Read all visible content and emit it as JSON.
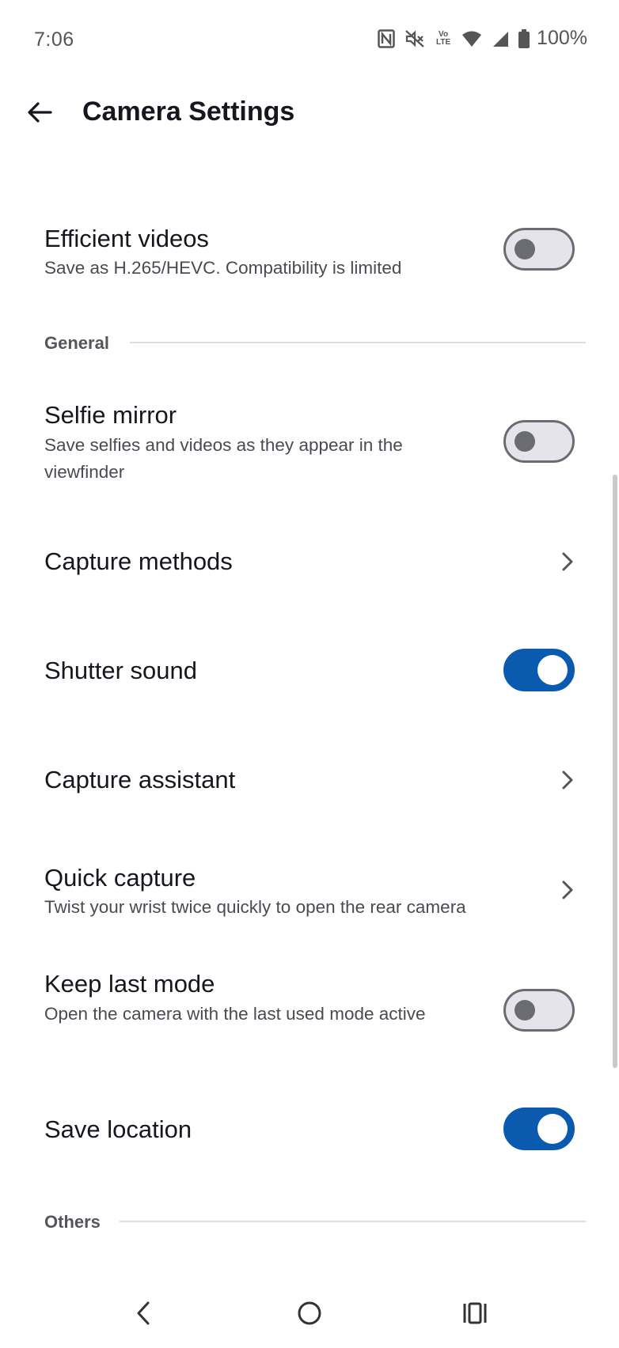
{
  "status_bar": {
    "time": "7:06",
    "battery": "100%",
    "volte_line1": "Vo",
    "volte_line2": "LTE",
    "icons": [
      "nfc-icon",
      "mute-icon",
      "volte-icon",
      "wifi-icon",
      "signal-icon",
      "battery-icon"
    ]
  },
  "header": {
    "title": "Camera Settings",
    "back_icon": "back-arrow-icon"
  },
  "settings": {
    "efficient_videos": {
      "title": "Efficient videos",
      "subtitle": "Save as H.265/HEVC. Compatibility is limited",
      "enabled": false
    },
    "general_header": "General",
    "selfie_mirror": {
      "title": "Selfie mirror",
      "subtitle": "Save selfies and videos as they appear in the viewfinder",
      "enabled": false
    },
    "capture_methods": {
      "title": "Capture methods"
    },
    "shutter_sound": {
      "title": "Shutter sound",
      "enabled": true
    },
    "capture_assistant": {
      "title": "Capture assistant"
    },
    "quick_capture": {
      "title": "Quick capture",
      "subtitle": "Twist your wrist twice quickly to open the rear camera"
    },
    "keep_last_mode": {
      "title": "Keep last mode",
      "subtitle": "Open the camera with the last used mode active",
      "enabled": false
    },
    "save_location": {
      "title": "Save location",
      "enabled": true
    },
    "others_header": "Others"
  },
  "colors": {
    "accent": "#0a5bb0",
    "toggle_off_track": "#e4e4ea",
    "toggle_off_border": "#6b6b72"
  },
  "nav_bar": {
    "icons": [
      "nav-back-icon",
      "nav-home-icon",
      "nav-recents-icon"
    ]
  }
}
